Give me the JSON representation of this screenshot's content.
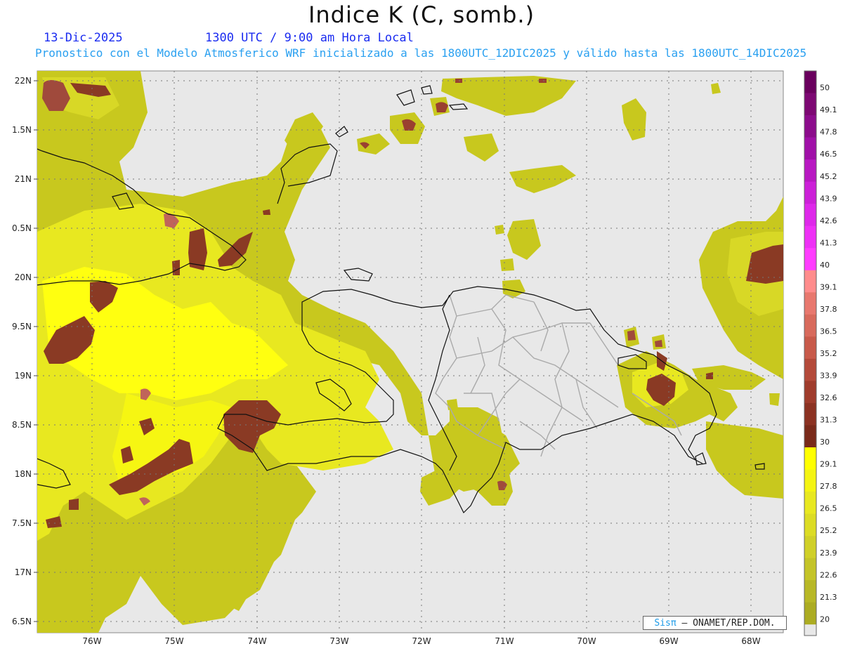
{
  "title": "Indice K (C, somb.)",
  "date": "13-Dic-2025",
  "time": "1300 UTC / 9:00 am Hora Local",
  "description": "Pronostico con el Modelo Atmosferico WRF inicializado a las 1800UTC_12DIC2025 y válido hasta las  1800UTC_14DIC2025",
  "credit": {
    "brand": "Sisπ",
    "org": "– ONAMET/REP.DOM."
  },
  "lat_labels": [
    "22N",
    "1.5N",
    "21N",
    "0.5N",
    "20N",
    "9.5N",
    "19N",
    "8.5N",
    "18N",
    "7.5N",
    "17N",
    "6.5N"
  ],
  "lon_labels": [
    "76W",
    "75W",
    "74W",
    "73W",
    "72W",
    "71W",
    "70W",
    "69W",
    "68W"
  ],
  "colorbar": {
    "labels": [
      "50",
      "49.1",
      "47.8",
      "46.5",
      "45.2",
      "43.9",
      "42.6",
      "41.3",
      "40",
      "39.1",
      "37.8",
      "36.5",
      "35.2",
      "33.9",
      "32.6",
      "31.3",
      "30",
      "29.1",
      "27.8",
      "26.5",
      "25.2",
      "23.9",
      "22.6",
      "21.3",
      "20"
    ],
    "colors": [
      "#6a005e",
      "#7d0873",
      "#8c0c8c",
      "#a010a8",
      "#b818c2",
      "#cc20d8",
      "#de28ea",
      "#ee30f6",
      "#ff3cff",
      "#ff8c8c",
      "#e8786e",
      "#d86a5c",
      "#c85a4a",
      "#b44a3a",
      "#a03c2c",
      "#8c3222",
      "#7a2a1a",
      "#ffff00",
      "#f4f412",
      "#e8e820",
      "#dcdc24",
      "#d0d028",
      "#c4c428",
      "#b8b826",
      "#acac22"
    ]
  },
  "colors": {
    "background": "#e8e8e8",
    "coast": "#111111",
    "border": "#aaaaaa"
  }
}
